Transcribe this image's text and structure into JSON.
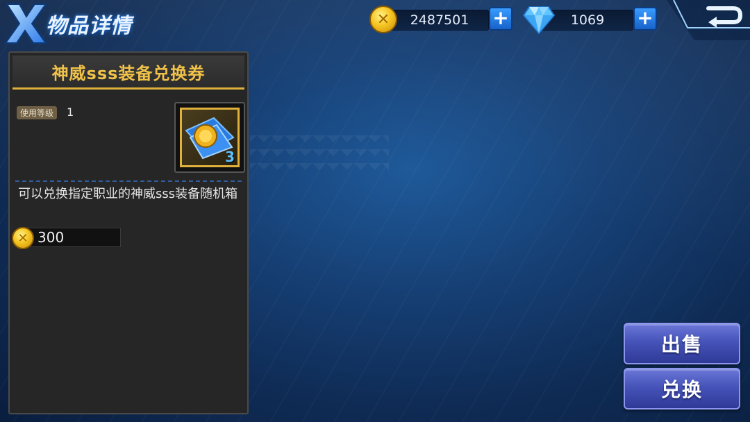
{
  "header": {
    "title": "物品详情"
  },
  "currency": {
    "gold_amount": "2487501",
    "diamond_amount": "1069",
    "gold_icon_glyph": "✕",
    "plus_glyph": "+"
  },
  "item": {
    "name": "神威sss装备兑换券",
    "level_label": "使用等级",
    "level_value": "1",
    "count": "3",
    "description": "可以兑换指定职业的神威sss装备随机箱",
    "price": "300",
    "price_icon_glyph": "✕"
  },
  "actions": {
    "sell_label": "出售",
    "exchange_label": "兑换"
  },
  "colors": {
    "accent_gold": "#e0b23c",
    "button_blue": "#4653b8",
    "background": "#163f74"
  },
  "icons": [
    "x-logo-icon",
    "gold-coin-icon",
    "diamond-icon",
    "plus-icon",
    "back-icon",
    "voucher-icon"
  ]
}
